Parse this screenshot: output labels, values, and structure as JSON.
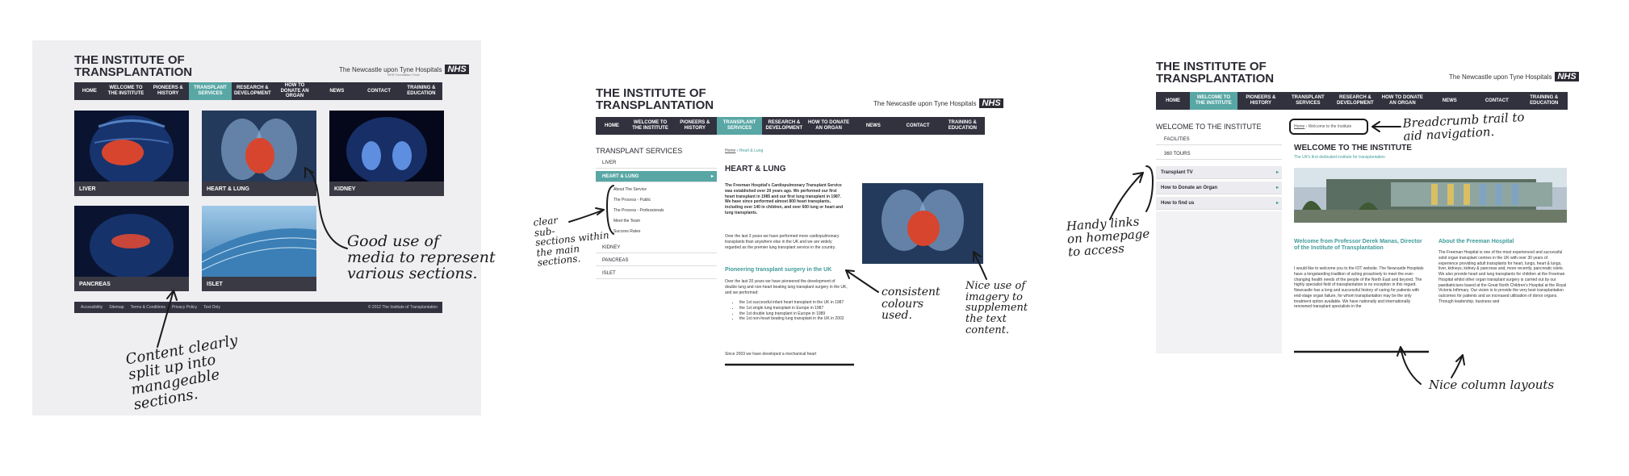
{
  "site": {
    "title_line1": "THE INSTITUTE OF",
    "title_line2": "TRANSPLANTATION",
    "trust_name": "The Newcastle upon Tyne Hospitals",
    "trust_sub": "NHS Foundation Trust",
    "nhs_badge": "NHS"
  },
  "nav": {
    "home": "HOME",
    "items": [
      "WELCOME TO THE INSTITUTE",
      "PIONEERS & HISTORY",
      "TRANSPLANT SERVICES",
      "RESEARCH & DEVELOPMENT",
      "HOW TO DONATE AN ORGAN",
      "NEWS",
      "CONTACT",
      "TRAINING & EDUCATION"
    ]
  },
  "panel1": {
    "tiles": [
      "LIVER",
      "HEART & LUNG",
      "KIDNEY",
      "PANCREAS",
      "ISLET"
    ],
    "footer_links": [
      "Accessibility",
      "Sitemap",
      "Terms & Conditions",
      "Privacy Policy",
      "Text Only"
    ],
    "footer_copy": "© 2012 The Institute of Transplantation"
  },
  "panel2": {
    "sidebar_title": "TRANSPLANT SERVICES",
    "sidebar_items": [
      "LIVER",
      "HEART & LUNG",
      "KIDNEY",
      "PANCREAS",
      "ISLET"
    ],
    "sidebar_sub": [
      "About The Service",
      "The Process - Public",
      "The Process - Professionals",
      "Meet the Team",
      "Success Rates"
    ],
    "breadcrumb_home": "Home",
    "breadcrumb_current": "Heart & Lung",
    "heading": "HEART & LUNG",
    "intro": "The Freeman Hospital's Cardiopulmonary Transplant Service was established over 20 years ago. We performed our first heart transplant in 1985 and our first lung transplant in 1987. We have since performed almost 800 heart transplants, including over 140 in children, and over 600 lung or heart and lung transplants.",
    "para1": "Over the last 3 years we have performed more cardiopulmonary transplants than anywhere else in the UK and we are widely regarded as the premier lung transplant service in the country.",
    "subheading": "Pioneering transplant surgery in the UK",
    "para2": "Over the last 20 years we have pioneered the development of double lung and non-heart beating lung transplant surgery in the UK, and we performed:",
    "bullets": [
      "the 1st successful infant heart transplant in the UK in 1987",
      "the 1st single lung transplant in Europe in 1987",
      "the 1st double lung transplant in Europe in 1989",
      "the 1st non-heart beating lung transplant in the UK in 2002"
    ],
    "para3": "Since 2003 we have developed a mechanical heart"
  },
  "panel3": {
    "sidebar_title": "WELCOME TO THE INSTITUTE",
    "sidebar_items": [
      "FACILITIES",
      "360 TOURS"
    ],
    "sidebar_links": [
      "Transplant TV",
      "How to Donate an Organ",
      "How to find us"
    ],
    "breadcrumb_home": "Home",
    "breadcrumb_current": "Welcome to the Institute",
    "heading": "WELCOME TO THE INSTITUTE",
    "subtitle": "The UK's first dedicated institute for transplantation",
    "col1_heading": "Welcome from Professor Derek Manas, Director of the Institute of Transplantation",
    "col1_text": "I would like to welcome you to the IOT website. The Newcastle Hospitals have a longstanding tradition of acting proactively to meet the ever-changing health needs of the people of the North East and beyond. The highly specialist field of transplantation is no exception in this regard. Newcastle has a long and successful history of caring for patients with end-stage organ failure, for whom transplantation may be the only treatment option available. We have nationally and internationally renowned transplant specialists in the",
    "col2_heading": "About the Freeman Hospital",
    "col2_text": "The Freeman Hospital is one of the most experienced and successful solid organ transplant centres in the UK with over 30 years of experience providing adult transplants for heart, lungs, heart & lungs, liver, kidneys, kidney & pancreas and, more recently, pancreatic islets. We also provide heart and lung transplants for children at the Freeman Hospital whilst other organ transplant surgery is carried out by our paediatricians based at the Great North Children's Hospital at the Royal Victoria Infirmary. Our vision is to provide the very best transplantation outcomes for patients and an increased utilisation of donor organs. Through leadership, business and"
  },
  "annotations": {
    "media": "Good use of\nmedia to represent\nvarious sections.",
    "content": "Content clearly\nsplit up into\nmanageable\nsections.",
    "subsections": "clear\nsub-\nsections within\nthe main\nsections.",
    "colours": "consistent\ncolours\nused.",
    "imagery": "Nice use of\nimagery to\nsupplement\nthe text\ncontent.",
    "handy_links": "Handy links\non homepage\nto access",
    "breadcrumb": "Breadcrumb trail to\naid navigation.",
    "columns": "Nice column layouts"
  },
  "colors": {
    "nav_bg": "#32323f",
    "accent": "#58a7a5",
    "panel1_bg": "#efeff2"
  }
}
